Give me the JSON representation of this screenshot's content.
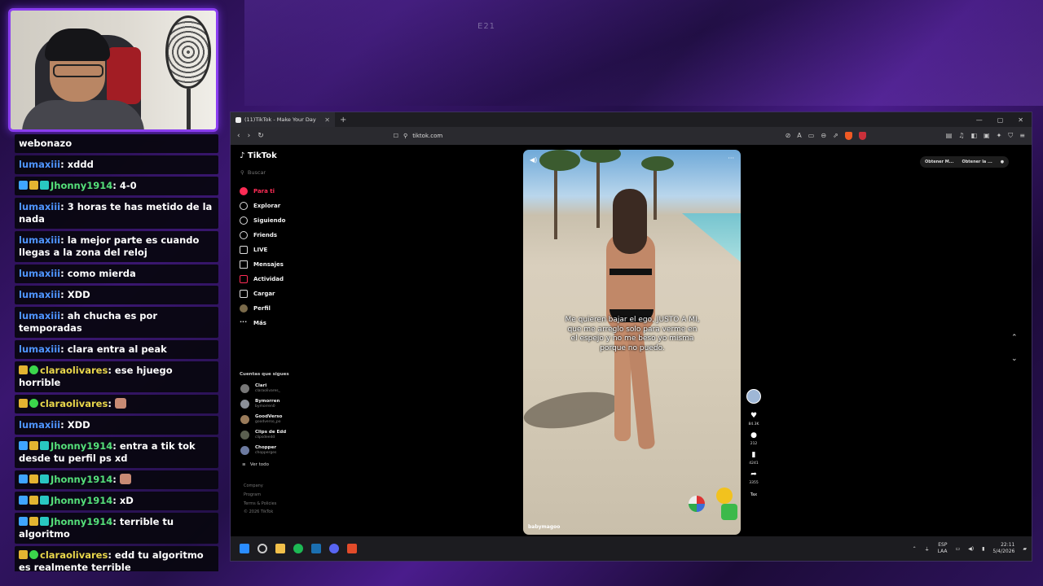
{
  "overlay": {
    "stream_tag": "E21"
  },
  "chat": [
    {
      "user": "",
      "badges": [],
      "text": "webonazo"
    },
    {
      "user": "lumaxiii",
      "color": "blue",
      "badges": [],
      "text": "xddd"
    },
    {
      "user": "Jhonny1914",
      "color": "green",
      "badges": [
        "blue",
        "gold",
        "teal"
      ],
      "text": "4-0"
    },
    {
      "user": "lumaxiii",
      "color": "blue",
      "badges": [],
      "text": "3 horas te has metido de la nada"
    },
    {
      "user": "lumaxiii",
      "color": "blue",
      "badges": [],
      "text": "la mejor parte es cuando llegas a la zona del reloj"
    },
    {
      "user": "lumaxiii",
      "color": "blue",
      "badges": [],
      "text": "como mierda"
    },
    {
      "user": "lumaxiii",
      "color": "blue",
      "badges": [],
      "text": "XDD"
    },
    {
      "user": "lumaxiii",
      "color": "blue",
      "badges": [],
      "text": "ah chucha es por temporadas"
    },
    {
      "user": "lumaxiii",
      "color": "blue",
      "badges": [],
      "text": "clara entra al peak"
    },
    {
      "user": "claraolivares",
      "color": "yellow",
      "badges": [
        "gold",
        "green"
      ],
      "text": "ese hjuego horrible"
    },
    {
      "user": "claraolivares",
      "color": "yellow",
      "badges": [
        "gold",
        "green"
      ],
      "text": "",
      "emote": true
    },
    {
      "user": "lumaxiii",
      "color": "blue",
      "badges": [],
      "text": "XDD"
    },
    {
      "user": "Jhonny1914",
      "color": "green",
      "badges": [
        "blue",
        "gold",
        "teal"
      ],
      "text": "entra a tik tok desde tu perfil ps xd"
    },
    {
      "user": "Jhonny1914",
      "color": "green",
      "badges": [
        "blue",
        "gold",
        "teal"
      ],
      "text": "",
      "emote": true
    },
    {
      "user": "Jhonny1914",
      "color": "green",
      "badges": [
        "blue",
        "gold",
        "teal"
      ],
      "text": "xD"
    },
    {
      "user": "Jhonny1914",
      "color": "green",
      "badges": [
        "blue",
        "gold",
        "teal"
      ],
      "text": "terrible tu algoritmo"
    },
    {
      "user": "claraolivares",
      "color": "yellow",
      "badges": [
        "gold",
        "green"
      ],
      "text": "edd tu algoritmo es realmente terrible"
    }
  ],
  "browser": {
    "tab_title": "(11)TikTok - Make Your Day",
    "url": "tiktok.com",
    "win_controls": [
      "—",
      "▢",
      "✕"
    ]
  },
  "tiktok": {
    "logo": "TikTok",
    "search_placeholder": "Buscar",
    "nav": [
      "Para ti",
      "Explorar",
      "Siguiendo",
      "Friends",
      "LIVE",
      "Mensajes",
      "Actividad",
      "Cargar",
      "Perfil",
      "Más"
    ],
    "following_title": "Cuentas que sigues",
    "accounts": [
      {
        "name": "Clari",
        "handle": "claraolivares_"
      },
      {
        "name": "Bymorren",
        "handle": "bymorren0"
      },
      {
        "name": "GoodVerso",
        "handle": "goodverso_po"
      },
      {
        "name": "Clips de Edd",
        "handle": "clipsdeedd"
      },
      {
        "name": "Chopper",
        "handle": "chopperges"
      }
    ],
    "see_all": "Ver todo",
    "footer": [
      "Company",
      "Program",
      "Terms & Policies",
      "© 2026 TikTok"
    ],
    "get_app": [
      "Obtener M...",
      "Obtener la ..."
    ],
    "video": {
      "caption": "Me quieren bajar el ego, JUSTO A MI, que me arreglo solo para verme en el espejo y no me beso yo misma porque no puedo.",
      "username": "babymagoo"
    },
    "actions": {
      "likes": "84.3K",
      "comments": "212",
      "saves": "4241",
      "shares": "3355",
      "music": "Tax"
    }
  },
  "taskbar": {
    "lang1": "ESP",
    "lang2": "LAA",
    "time": "22:11",
    "date": "5/4/2026"
  }
}
